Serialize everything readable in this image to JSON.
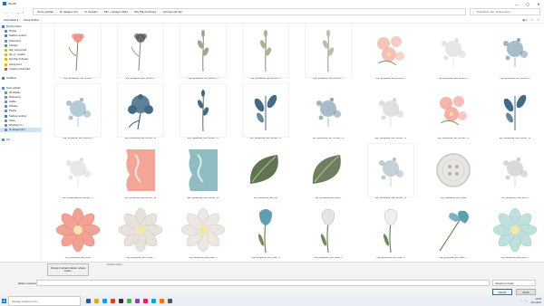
{
  "window": {
    "title": "Otevřít",
    "controls": [
      "—",
      "▢",
      "✕"
    ]
  },
  "address": {
    "path": [
      "Tento počítač",
      "dt. designs (D:)",
      "dt. designs",
      "Kits + designs 2021",
      "Kits Play February",
      "springmood dsp"
    ],
    "search_placeholder": "Prohledat: dsp_springmood"
  },
  "toolbar": {
    "organize": "Uspořádat ▾",
    "new_folder": "Nová složka"
  },
  "sidebar": [
    {
      "label": "Rychlý přístup",
      "color": "#3a7bd5"
    },
    {
      "label": "Plocha",
      "color": "#4a90e2"
    },
    {
      "label": "Stažené soubory",
      "color": "#3a7bd5"
    },
    {
      "label": "Dokumenty",
      "color": "#7a8fa6"
    },
    {
      "label": "Obrázky",
      "color": "#4a90e2"
    },
    {
      "label": "dsp_springmood",
      "color": "#e6b800"
    },
    {
      "label": "elit_cz_creation",
      "color": "#e6b800"
    },
    {
      "label": "Kits Play February",
      "color": "#e6b800"
    },
    {
      "label": "springmood",
      "color": "#e6b800"
    },
    {
      "label": "Creative Cloud Files",
      "color": "#d9534f"
    },
    {
      "label": "",
      "color": "transparent"
    },
    {
      "label": "OneDrive",
      "color": "#3a7bd5"
    },
    {
      "label": "",
      "color": "transparent"
    },
    {
      "label": "Tento počítač",
      "color": "#4a90e2"
    },
    {
      "label": "3D objekty",
      "color": "#7a8fa6"
    },
    {
      "label": "Dokumenty",
      "color": "#7a8fa6"
    },
    {
      "label": "Hudba",
      "color": "#7a8fa6"
    },
    {
      "label": "Obrázky",
      "color": "#4a90e2"
    },
    {
      "label": "Plocha",
      "color": "#4a90e2"
    },
    {
      "label": "Stažené soubory",
      "color": "#3a7bd5"
    },
    {
      "label": "Videa",
      "color": "#7a8fa6"
    },
    {
      "label": "Windows (C:)",
      "color": "#7a8fa6"
    },
    {
      "label": "dt. designs (D:)",
      "color": "#7a8fa6",
      "selected": true
    },
    {
      "label": "",
      "color": "transparent"
    },
    {
      "label": "Síť",
      "color": "#4a90e2"
    }
  ],
  "files": [
    {
      "name": "dsp_springmood_elite_brushes",
      "kind": "flower",
      "color": "#e98b7a",
      "stem": "#6b8f5a",
      "paper": true
    },
    {
      "name": "dsp_springmood_elite_brushes_2",
      "kind": "flower",
      "color": "#555",
      "stem": "#888",
      "paper": true
    },
    {
      "name": "dsp_springmood_elite_brushes_3",
      "kind": "stem",
      "color": "#98a98c",
      "stem": "#7d8f6d",
      "paper": true
    },
    {
      "name": "dsp_springmood_elite_brushes_4",
      "kind": "stem",
      "color": "#a7b58e",
      "stem": "#7d8f6d",
      "paper": true
    },
    {
      "name": "dsp_springmood_elite_brushes_5",
      "kind": "stem",
      "color": "#b7c0a8",
      "stem": "#8a9a7a",
      "paper": true
    },
    {
      "name": "dsp_springmood_elite_brushes_6",
      "kind": "cluster",
      "color": "#f0b6a8",
      "stem": "#8a9a7a",
      "paper": false
    },
    {
      "name": "dsp_springmood_elite_brushes_7",
      "kind": "splatter",
      "color": "#c8c8c8",
      "stem": "#aaa",
      "paper": false
    },
    {
      "name": "dsp_springmood_elite_brushes_8",
      "kind": "splatter",
      "color": "#3f6b86",
      "stem": "#3f6b86",
      "paper": false
    },
    {
      "name": "dsp_springmood_elite_brushes_9",
      "kind": "splatter",
      "color": "#5b8aa6",
      "stem": "#5b8aa6",
      "paper": true
    },
    {
      "name": "dsp_springmood_elite_brushes_10",
      "kind": "blossom",
      "color": "#3f6b86",
      "stem": "#3f6b86",
      "paper": true
    },
    {
      "name": "dsp_springmood_elite_brushes_11",
      "kind": "stem",
      "color": "#3f6b86",
      "stem": "#5d6b55",
      "paper": true
    },
    {
      "name": "dsp_springmood_elite_brushes_12",
      "kind": "leaves",
      "color": "#3f6b86",
      "stem": "#3f6b86",
      "paper": true
    },
    {
      "name": "dsp_springmood_elite_brushes_13",
      "kind": "splatter",
      "color": "#3f6b86",
      "stem": "#3f6b86",
      "paper": false
    },
    {
      "name": "dsp_springmood_elite_brushes_14",
      "kind": "splatter",
      "color": "#bbb",
      "stem": "#bbb",
      "paper": false
    },
    {
      "name": "dsp_springmood_elite_brushes_15",
      "kind": "cluster",
      "color": "#f2a39a",
      "stem": "#8a9a7a",
      "paper": false
    },
    {
      "name": "dsp_springmood_elite_brushes_16",
      "kind": "leaves",
      "color": "#3f6b86",
      "stem": "#3f6b86",
      "paper": false
    },
    {
      "name": "dsp_springmood_elite_brushes_17",
      "kind": "splatter",
      "color": "#ccc",
      "stem": "#ccc",
      "paper": false
    },
    {
      "name": "dsp_springmood_elite_brushes_18",
      "kind": "paint",
      "color": "#f3a596",
      "stem": "#f3a596",
      "paper": false
    },
    {
      "name": "dsp_springmood_elite_brushes_19",
      "kind": "paint",
      "color": "#8fbcc0",
      "stem": "#8fbcc0",
      "paper": false
    },
    {
      "name": "dsp_springmood_elite_leaf",
      "kind": "leafbig",
      "color": "#5e7550",
      "stem": "#5e7550",
      "paper": false
    },
    {
      "name": "dsp_springmood_elite_leaf_2",
      "kind": "leafbig",
      "color": "#6f7f5e",
      "stem": "#6f7f5e",
      "paper": false
    },
    {
      "name": "dsp_springmood_elite_brushes_20",
      "kind": "splatter",
      "color": "#7e97a6",
      "stem": "#7e97a6",
      "paper": true
    },
    {
      "name": "dsp_springmood_elite_button",
      "kind": "button",
      "color": "#e8e6e1",
      "stem": "#ccc",
      "paper": false
    },
    {
      "name": "dsp_springmood_elite_flower1",
      "kind": "splatter",
      "color": "#aaa",
      "stem": "#aaa",
      "paper": false
    },
    {
      "name": "dsp_springmood_elite_flower",
      "kind": "bigflower",
      "color": "#f2a294",
      "stem": "#e27f6f",
      "paper": false
    },
    {
      "name": "dsp_springmood_elite_flower_2",
      "kind": "bigflower",
      "color": "#e7e2dc",
      "stem": "#c9c1b8",
      "paper": false
    },
    {
      "name": "dsp_springmood_elite_flower_3",
      "kind": "bigflower",
      "color": "#ece7e2",
      "stem": "#cfc7bf",
      "paper": false
    },
    {
      "name": "dsp_springmood_elite_flower_4",
      "kind": "tulip",
      "color": "#5c9fb0",
      "stem": "#6f8a5b",
      "paper": false
    },
    {
      "name": "dsp_springmood_elite_flower_5",
      "kind": "tulip",
      "color": "#e5e5de",
      "stem": "#6f8a5b",
      "paper": false
    },
    {
      "name": "dsp_springmood_elite_flower_6",
      "kind": "tulip",
      "color": "#f0f0ea",
      "stem": "#6f8a5b",
      "paper": false
    },
    {
      "name": "dsp_springmood_elite_flower_7",
      "kind": "lily",
      "color": "#5aa1b2",
      "stem": "#6f8a5b",
      "paper": false
    },
    {
      "name": "dsp_springmood_elite_flower_8",
      "kind": "bigflower",
      "color": "#bfe0dc",
      "stem": "#9ccac5",
      "paper": false
    },
    {
      "name": "dsp_springmood_elite_flower_9",
      "kind": "partial",
      "color": "#e5ded6",
      "stem": "#ccc",
      "paper": false
    },
    {
      "name": "dsp_springmood_elite_flower_10",
      "kind": "partial",
      "color": "#dcd6cf",
      "stem": "#ccc",
      "paper": false
    },
    {
      "name": "dsp_springmood_elite_flower_11",
      "kind": "partial",
      "color": "#5c9fb0",
      "stem": "#ccc",
      "paper": false
    },
    {
      "name": "dsp_springmood_elite_flower_12",
      "kind": "partial",
      "color": "#f2a294",
      "stem": "#ccc",
      "paper": false
    },
    {
      "name": "dsp_springmood_elite_flower_13",
      "kind": "partial",
      "color": "#eee",
      "stem": "#ccc",
      "paper": false
    },
    {
      "name": "dsp_springmood_elite_flower_14",
      "kind": "partial",
      "color": "#f2a294",
      "stem": "#ccc",
      "paper": false
    },
    {
      "name": "dsp_springmood_elite_flower_15",
      "kind": "partial",
      "color": "#e6e6e6",
      "stem": "#ccc",
      "paper": false
    },
    {
      "name": "dsp_springmood_elite_flower_16",
      "kind": "partial",
      "color": "#6f8a5b",
      "stem": "#ccc",
      "paper": false
    }
  ],
  "footer": {
    "preview_tip": "Chcete-li zobrazit náhled, vyberte soubor.",
    "preview_hint": "Zobrazit náhled",
    "filename_label": "Název souboru:",
    "filename_value": "",
    "filetype": "Všechny formáty",
    "open": "Otevřít",
    "cancel": "Zrušit"
  },
  "taskbar": {
    "search": "Hledejte zadáním textu",
    "time": "10:54",
    "date": "25.2.2021",
    "apps": [
      "#2b579a",
      "#f0a30a",
      "#1e90ff",
      "#d24726",
      "#333",
      "#4caf50",
      "#8e44ad",
      "#e91e63",
      "#00a4ef",
      "#ff6f00",
      "#555"
    ]
  }
}
